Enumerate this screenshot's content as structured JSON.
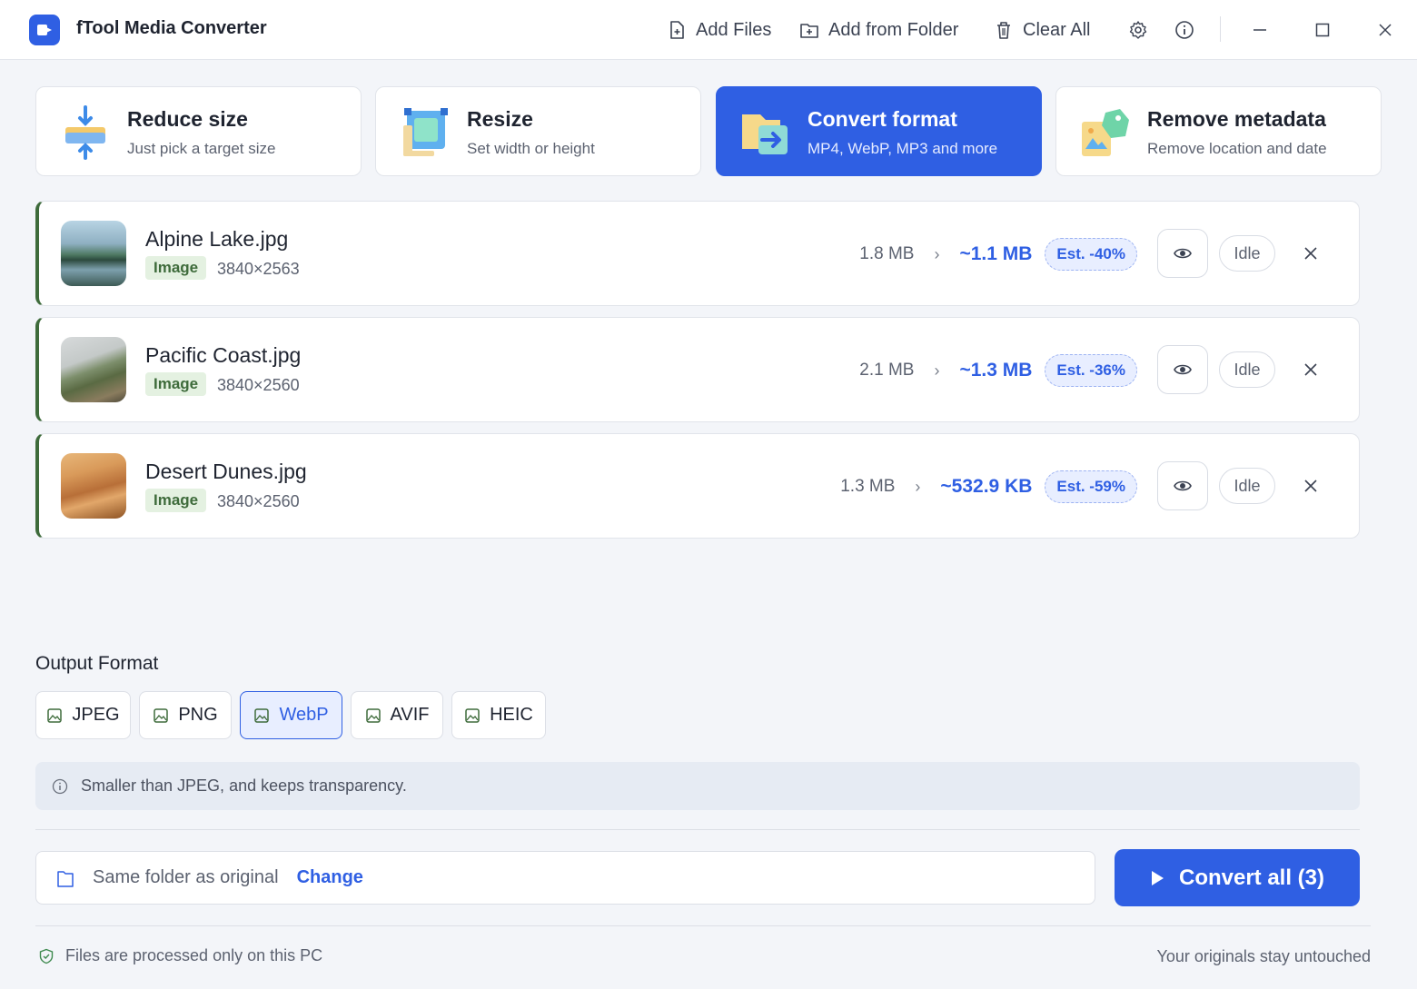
{
  "app": {
    "title": "fTool Media Converter"
  },
  "toolbar": {
    "add_files": "Add Files",
    "add_folder": "Add from Folder",
    "clear_all": "Clear All",
    "icons": [
      "settings-icon",
      "info-icon"
    ],
    "window_controls": [
      "minimize",
      "maximize",
      "close"
    ]
  },
  "modes": [
    {
      "title": "Reduce size",
      "subtitle": "Just pick a target size",
      "icon": "compress-icon",
      "active": false
    },
    {
      "title": "Resize",
      "subtitle": "Set width or height",
      "icon": "resize-icon",
      "active": false
    },
    {
      "title": "Convert format",
      "subtitle": "MP4, WebP, MP3 and more",
      "icon": "convert-icon",
      "active": true
    },
    {
      "title": "Remove metadata",
      "subtitle": "Remove location and date",
      "icon": "metadata-tag-icon",
      "active": false
    }
  ],
  "files": [
    {
      "name": "Alpine Lake.jpg",
      "type": "Image",
      "dims": "3840×2563",
      "orig_size": "1.8 MB",
      "new_size": "~1.1 MB",
      "estimate": "Est. -40%",
      "status": "Idle"
    },
    {
      "name": "Pacific Coast.jpg",
      "type": "Image",
      "dims": "3840×2560",
      "orig_size": "2.1 MB",
      "new_size": "~1.3 MB",
      "estimate": "Est. -36%",
      "status": "Idle"
    },
    {
      "name": "Desert Dunes.jpg",
      "type": "Image",
      "dims": "3840×2560",
      "orig_size": "1.3 MB",
      "new_size": "~532.9 KB",
      "estimate": "Est. -59%",
      "status": "Idle"
    }
  ],
  "output": {
    "label": "Output Format",
    "formats": [
      "JPEG",
      "PNG",
      "WebP",
      "AVIF",
      "HEIC"
    ],
    "selected": "WebP",
    "hint": "Smaller than JPEG, and keeps transparency."
  },
  "destination": {
    "text": "Same folder as original",
    "change": "Change"
  },
  "convert_button": "Convert all (3)",
  "footer": {
    "left": "Files are processed only on this PC",
    "right": "Your originals stay untouched"
  },
  "colors": {
    "accent": "#2f5fe3",
    "image_badge": "#3e6b3b",
    "background": "#f3f5f9"
  }
}
